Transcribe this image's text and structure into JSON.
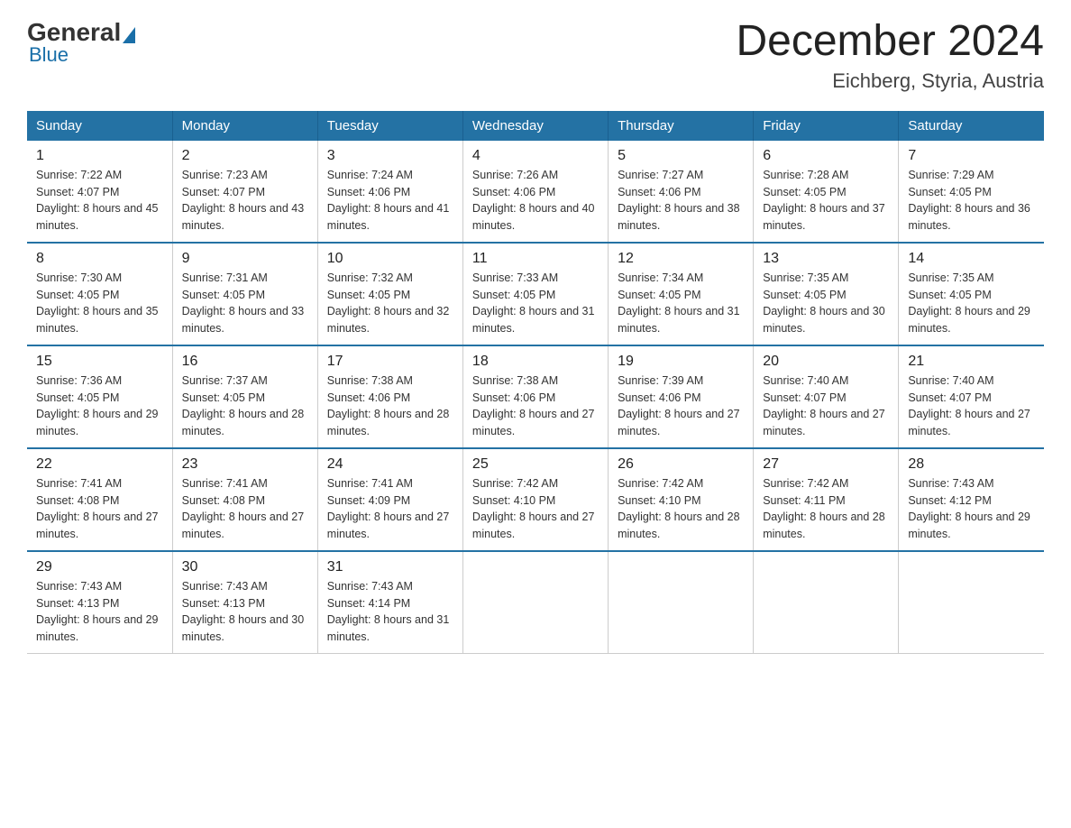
{
  "header": {
    "logo": {
      "text_before": "General",
      "text_after": "Blue"
    },
    "title": "December 2024",
    "location": "Eichberg, Styria, Austria"
  },
  "days_of_week": [
    "Sunday",
    "Monday",
    "Tuesday",
    "Wednesday",
    "Thursday",
    "Friday",
    "Saturday"
  ],
  "weeks": [
    [
      {
        "day": "1",
        "sunrise": "7:22 AM",
        "sunset": "4:07 PM",
        "daylight": "8 hours and 45 minutes."
      },
      {
        "day": "2",
        "sunrise": "7:23 AM",
        "sunset": "4:07 PM",
        "daylight": "8 hours and 43 minutes."
      },
      {
        "day": "3",
        "sunrise": "7:24 AM",
        "sunset": "4:06 PM",
        "daylight": "8 hours and 41 minutes."
      },
      {
        "day": "4",
        "sunrise": "7:26 AM",
        "sunset": "4:06 PM",
        "daylight": "8 hours and 40 minutes."
      },
      {
        "day": "5",
        "sunrise": "7:27 AM",
        "sunset": "4:06 PM",
        "daylight": "8 hours and 38 minutes."
      },
      {
        "day": "6",
        "sunrise": "7:28 AM",
        "sunset": "4:05 PM",
        "daylight": "8 hours and 37 minutes."
      },
      {
        "day": "7",
        "sunrise": "7:29 AM",
        "sunset": "4:05 PM",
        "daylight": "8 hours and 36 minutes."
      }
    ],
    [
      {
        "day": "8",
        "sunrise": "7:30 AM",
        "sunset": "4:05 PM",
        "daylight": "8 hours and 35 minutes."
      },
      {
        "day": "9",
        "sunrise": "7:31 AM",
        "sunset": "4:05 PM",
        "daylight": "8 hours and 33 minutes."
      },
      {
        "day": "10",
        "sunrise": "7:32 AM",
        "sunset": "4:05 PM",
        "daylight": "8 hours and 32 minutes."
      },
      {
        "day": "11",
        "sunrise": "7:33 AM",
        "sunset": "4:05 PM",
        "daylight": "8 hours and 31 minutes."
      },
      {
        "day": "12",
        "sunrise": "7:34 AM",
        "sunset": "4:05 PM",
        "daylight": "8 hours and 31 minutes."
      },
      {
        "day": "13",
        "sunrise": "7:35 AM",
        "sunset": "4:05 PM",
        "daylight": "8 hours and 30 minutes."
      },
      {
        "day": "14",
        "sunrise": "7:35 AM",
        "sunset": "4:05 PM",
        "daylight": "8 hours and 29 minutes."
      }
    ],
    [
      {
        "day": "15",
        "sunrise": "7:36 AM",
        "sunset": "4:05 PM",
        "daylight": "8 hours and 29 minutes."
      },
      {
        "day": "16",
        "sunrise": "7:37 AM",
        "sunset": "4:05 PM",
        "daylight": "8 hours and 28 minutes."
      },
      {
        "day": "17",
        "sunrise": "7:38 AM",
        "sunset": "4:06 PM",
        "daylight": "8 hours and 28 minutes."
      },
      {
        "day": "18",
        "sunrise": "7:38 AM",
        "sunset": "4:06 PM",
        "daylight": "8 hours and 27 minutes."
      },
      {
        "day": "19",
        "sunrise": "7:39 AM",
        "sunset": "4:06 PM",
        "daylight": "8 hours and 27 minutes."
      },
      {
        "day": "20",
        "sunrise": "7:40 AM",
        "sunset": "4:07 PM",
        "daylight": "8 hours and 27 minutes."
      },
      {
        "day": "21",
        "sunrise": "7:40 AM",
        "sunset": "4:07 PM",
        "daylight": "8 hours and 27 minutes."
      }
    ],
    [
      {
        "day": "22",
        "sunrise": "7:41 AM",
        "sunset": "4:08 PM",
        "daylight": "8 hours and 27 minutes."
      },
      {
        "day": "23",
        "sunrise": "7:41 AM",
        "sunset": "4:08 PM",
        "daylight": "8 hours and 27 minutes."
      },
      {
        "day": "24",
        "sunrise": "7:41 AM",
        "sunset": "4:09 PM",
        "daylight": "8 hours and 27 minutes."
      },
      {
        "day": "25",
        "sunrise": "7:42 AM",
        "sunset": "4:10 PM",
        "daylight": "8 hours and 27 minutes."
      },
      {
        "day": "26",
        "sunrise": "7:42 AM",
        "sunset": "4:10 PM",
        "daylight": "8 hours and 28 minutes."
      },
      {
        "day": "27",
        "sunrise": "7:42 AM",
        "sunset": "4:11 PM",
        "daylight": "8 hours and 28 minutes."
      },
      {
        "day": "28",
        "sunrise": "7:43 AM",
        "sunset": "4:12 PM",
        "daylight": "8 hours and 29 minutes."
      }
    ],
    [
      {
        "day": "29",
        "sunrise": "7:43 AM",
        "sunset": "4:13 PM",
        "daylight": "8 hours and 29 minutes."
      },
      {
        "day": "30",
        "sunrise": "7:43 AM",
        "sunset": "4:13 PM",
        "daylight": "8 hours and 30 minutes."
      },
      {
        "day": "31",
        "sunrise": "7:43 AM",
        "sunset": "4:14 PM",
        "daylight": "8 hours and 31 minutes."
      },
      null,
      null,
      null,
      null
    ]
  ]
}
